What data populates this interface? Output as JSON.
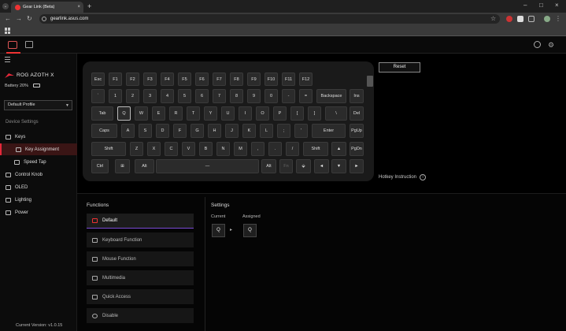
{
  "browser": {
    "tab_title": "Gear Link (Beta)",
    "tab_close": "×",
    "new_tab": "+",
    "url": "gearlink.asus.com",
    "tablist_glyph": "⌄",
    "minimize": "–",
    "maximize": "□",
    "close": "×",
    "back": "←",
    "forward": "→",
    "reload": "↻",
    "star": "☆"
  },
  "app": {
    "gear_glyph": "⚙"
  },
  "sidebar": {
    "device_name": "ROG AZOTH X",
    "battery": "Battery 20%",
    "profile": "Default Profile",
    "profile_chev": "▼",
    "device_settings": "Device Settings",
    "items": [
      {
        "label": "Keys"
      },
      {
        "label": "Key Assignment"
      },
      {
        "label": "Speed Tap"
      },
      {
        "label": "Control Knob"
      },
      {
        "label": "OLED"
      },
      {
        "label": "Lighting"
      },
      {
        "label": "Power"
      }
    ],
    "version": "Current Version: v1.0.15"
  },
  "keyboard": {
    "rows": [
      [
        "Esc",
        "F1",
        "F2",
        "F3",
        "F4",
        "F5",
        "F6",
        "F7",
        "F8",
        "F9",
        "F10",
        "F11",
        "F12"
      ],
      [
        "`",
        "1",
        "2",
        "3",
        "4",
        "5",
        "6",
        "7",
        "8",
        "9",
        "0",
        "-",
        "=",
        "Backspace",
        "Ins"
      ],
      [
        "Tab",
        "Q",
        "W",
        "E",
        "R",
        "T",
        "Y",
        "U",
        "I",
        "O",
        "P",
        "[",
        "]",
        "\\",
        "Del"
      ],
      [
        "Caps",
        "A",
        "S",
        "D",
        "F",
        "G",
        "H",
        "J",
        "K",
        "L",
        ";",
        "'",
        "Enter",
        "PgUp"
      ],
      [
        "Shift",
        "Z",
        "X",
        "C",
        "V",
        "B",
        "N",
        "M",
        ",",
        ".",
        "/",
        "Shift",
        "▲",
        "PgDn"
      ],
      [
        "Ctrl",
        "⊞",
        "Alt",
        "—",
        "Alt",
        "Fn",
        "⬙",
        "◄",
        "▼",
        "►"
      ]
    ]
  },
  "main": {
    "reset": "Reset",
    "hotkey": "Hotkey Instruction",
    "hotkey_glyph": "i"
  },
  "functions": {
    "title": "Functions",
    "items": [
      {
        "label": "Default"
      },
      {
        "label": "Keyboard Function"
      },
      {
        "label": "Mouse Function"
      },
      {
        "label": "Multimedia"
      },
      {
        "label": "Quick Access"
      },
      {
        "label": "Disable"
      }
    ]
  },
  "settings": {
    "title": "Settings",
    "current_label": "Current",
    "assigned_label": "Assigned",
    "current_key": "Q",
    "assigned_key": "Q",
    "arrow": "▸"
  },
  "colors": {
    "accent": "#e3283a",
    "default_underline": "#7a4ad5"
  }
}
